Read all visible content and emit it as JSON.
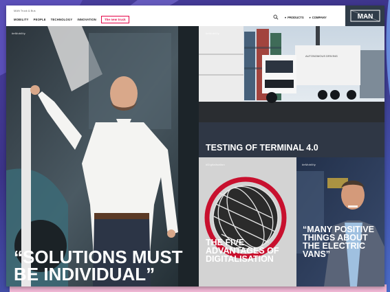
{
  "header": {
    "brand_line": "MAN Truck & Bus",
    "nav": [
      "MOBILITY",
      "PEOPLE",
      "TECHNOLOGY",
      "INNOVATION"
    ],
    "cta": "The new truck",
    "right_nav": [
      "PRODUCTS",
      "COMPANY"
    ],
    "logo_text": "MAN"
  },
  "tiles": {
    "left": {
      "tag": "#eMobility",
      "headline": "“SOLUTIONS MUST BE INDIVIDUAL”"
    },
    "truck": {
      "tag": "#eMobility",
      "headline": "TESTING OF TERMINAL 4.0"
    },
    "globe": {
      "tag": "#Digitalisation",
      "headline": "THE FIVE ADVANTAGES OF DIGITALISATION"
    },
    "man": {
      "tag": "#eMobility",
      "headline": "“MANY POSITIVE THINGS ABOUT THE ELECTRIC VANS”"
    }
  },
  "colors": {
    "accent": "#e40045",
    "header_logo_bg": "#303c49",
    "frame_bg": "#3b3388",
    "bottom_strip": "#f2b8d6",
    "globe_ring": "#c8102e"
  },
  "icons": [
    "search-icon",
    "man-logo-icon",
    "globe-icon"
  ]
}
